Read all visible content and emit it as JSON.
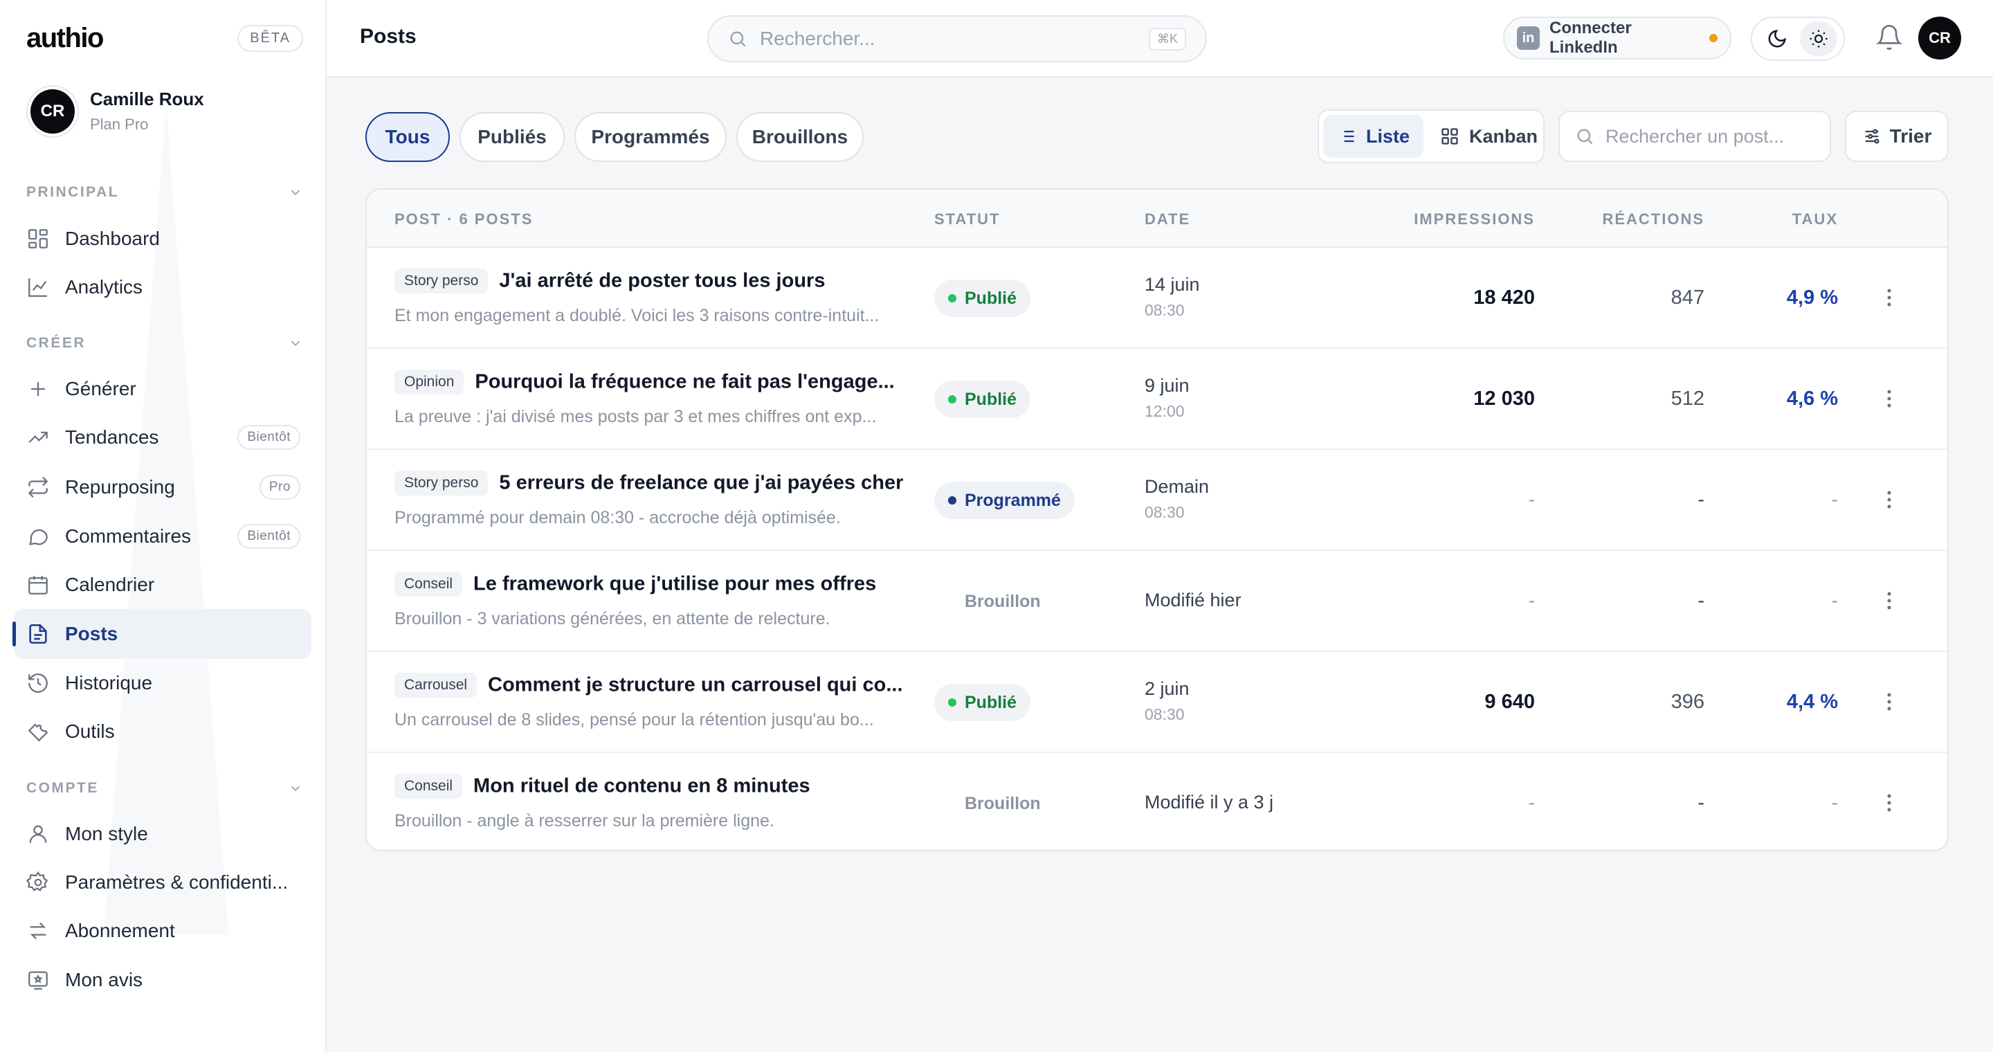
{
  "brand": {
    "logo": "authio",
    "beta": "BÊTA"
  },
  "profile": {
    "initials": "CR",
    "name": "Camille Roux",
    "plan": "Plan Pro"
  },
  "sidebar": {
    "sections": [
      {
        "title": "PRINCIPAL",
        "items": [
          {
            "label": "Dashboard",
            "icon": "dashboard-icon"
          },
          {
            "label": "Analytics",
            "icon": "analytics-icon"
          }
        ]
      },
      {
        "title": "CRÉER",
        "items": [
          {
            "label": "Générer",
            "icon": "plus-icon"
          },
          {
            "label": "Tendances",
            "icon": "trend-icon",
            "badge": "Bientôt"
          },
          {
            "label": "Repurposing",
            "icon": "repeat-icon",
            "badge": "Pro"
          },
          {
            "label": "Commentaires",
            "icon": "comment-icon",
            "badge": "Bientôt"
          },
          {
            "label": "Calendrier",
            "icon": "calendar-icon"
          },
          {
            "label": "Posts",
            "icon": "document-icon",
            "active": true
          },
          {
            "label": "Historique",
            "icon": "history-icon"
          },
          {
            "label": "Outils",
            "icon": "wrench-icon"
          }
        ]
      },
      {
        "title": "COMPTE",
        "items": [
          {
            "label": "Mon style",
            "icon": "user-icon"
          },
          {
            "label": "Paramètres & confidenti...",
            "icon": "gear-icon"
          },
          {
            "label": "Abonnement",
            "icon": "arrows-icon"
          },
          {
            "label": "Mon avis",
            "icon": "feedback-icon"
          }
        ]
      }
    ]
  },
  "topbar": {
    "title": "Posts",
    "search_placeholder": "Rechercher...",
    "search_shortcut": "⌘K",
    "linkedin_label": "Connecter LinkedIn",
    "linkedin_icon_text": "in",
    "avatar_initials": "CR"
  },
  "filters": [
    {
      "label": "Tous",
      "active": true
    },
    {
      "label": "Publiés"
    },
    {
      "label": "Programmés"
    },
    {
      "label": "Brouillons"
    }
  ],
  "views": {
    "list": "Liste",
    "kanban": "Kanban",
    "active": "list"
  },
  "post_search_placeholder": "Rechercher un post...",
  "sort_label": "Trier",
  "table": {
    "headers": {
      "post": "POST · 6 POSTS",
      "status": "STATUT",
      "date": "DATE",
      "impressions": "IMPRESSIONS",
      "reactions": "RÉACTIONS",
      "rate": "TAUX"
    },
    "rows": [
      {
        "tag": "Story perso",
        "title": "J'ai arrêté de poster tous les jours",
        "excerpt": "Et mon engagement a doublé. Voici les 3 raisons contre-intuit...",
        "status": "Publié",
        "status_kind": "pub",
        "date": "14 juin",
        "time": "08:30",
        "impressions": "18 420",
        "reactions": "847",
        "rate": "4,9 %"
      },
      {
        "tag": "Opinion",
        "title": "Pourquoi la fréquence ne fait pas l'engage...",
        "excerpt": "La preuve : j'ai divisé mes posts par 3 et mes chiffres ont exp...",
        "status": "Publié",
        "status_kind": "pub",
        "date": "9 juin",
        "time": "12:00",
        "impressions": "12 030",
        "reactions": "512",
        "rate": "4,6 %"
      },
      {
        "tag": "Story perso",
        "title": "5 erreurs de freelance que j'ai payées cher",
        "excerpt": "Programmé pour demain 08:30 - accroche déjà optimisée.",
        "status": "Programmé",
        "status_kind": "prog",
        "date": "Demain",
        "time": "08:30",
        "impressions": "-",
        "reactions": "-",
        "rate": "-"
      },
      {
        "tag": "Conseil",
        "title": "Le framework que j'utilise pour mes offres",
        "excerpt": "Brouillon - 3 variations générées, en attente de relecture.",
        "status": "Brouillon",
        "status_kind": "draft",
        "date": "Modifié hier",
        "time": "",
        "impressions": "-",
        "reactions": "-",
        "rate": "-"
      },
      {
        "tag": "Carrousel",
        "title": "Comment je structure un carrousel qui co...",
        "excerpt": "Un carrousel de 8 slides, pensé pour la rétention jusqu'au bo...",
        "status": "Publié",
        "status_kind": "pub",
        "date": "2 juin",
        "time": "08:30",
        "impressions": "9 640",
        "reactions": "396",
        "rate": "4,4 %"
      },
      {
        "tag": "Conseil",
        "title": "Mon rituel de contenu en 8 minutes",
        "excerpt": "Brouillon - angle à resserrer sur la première ligne.",
        "status": "Brouillon",
        "status_kind": "draft",
        "date": "Modifié il y a 3 j",
        "time": "",
        "impressions": "-",
        "reactions": "-",
        "rate": "-"
      }
    ]
  },
  "colors": {
    "accent": "#1e3a8a",
    "published": "#15803d",
    "warning_dot": "#f59e0b"
  }
}
